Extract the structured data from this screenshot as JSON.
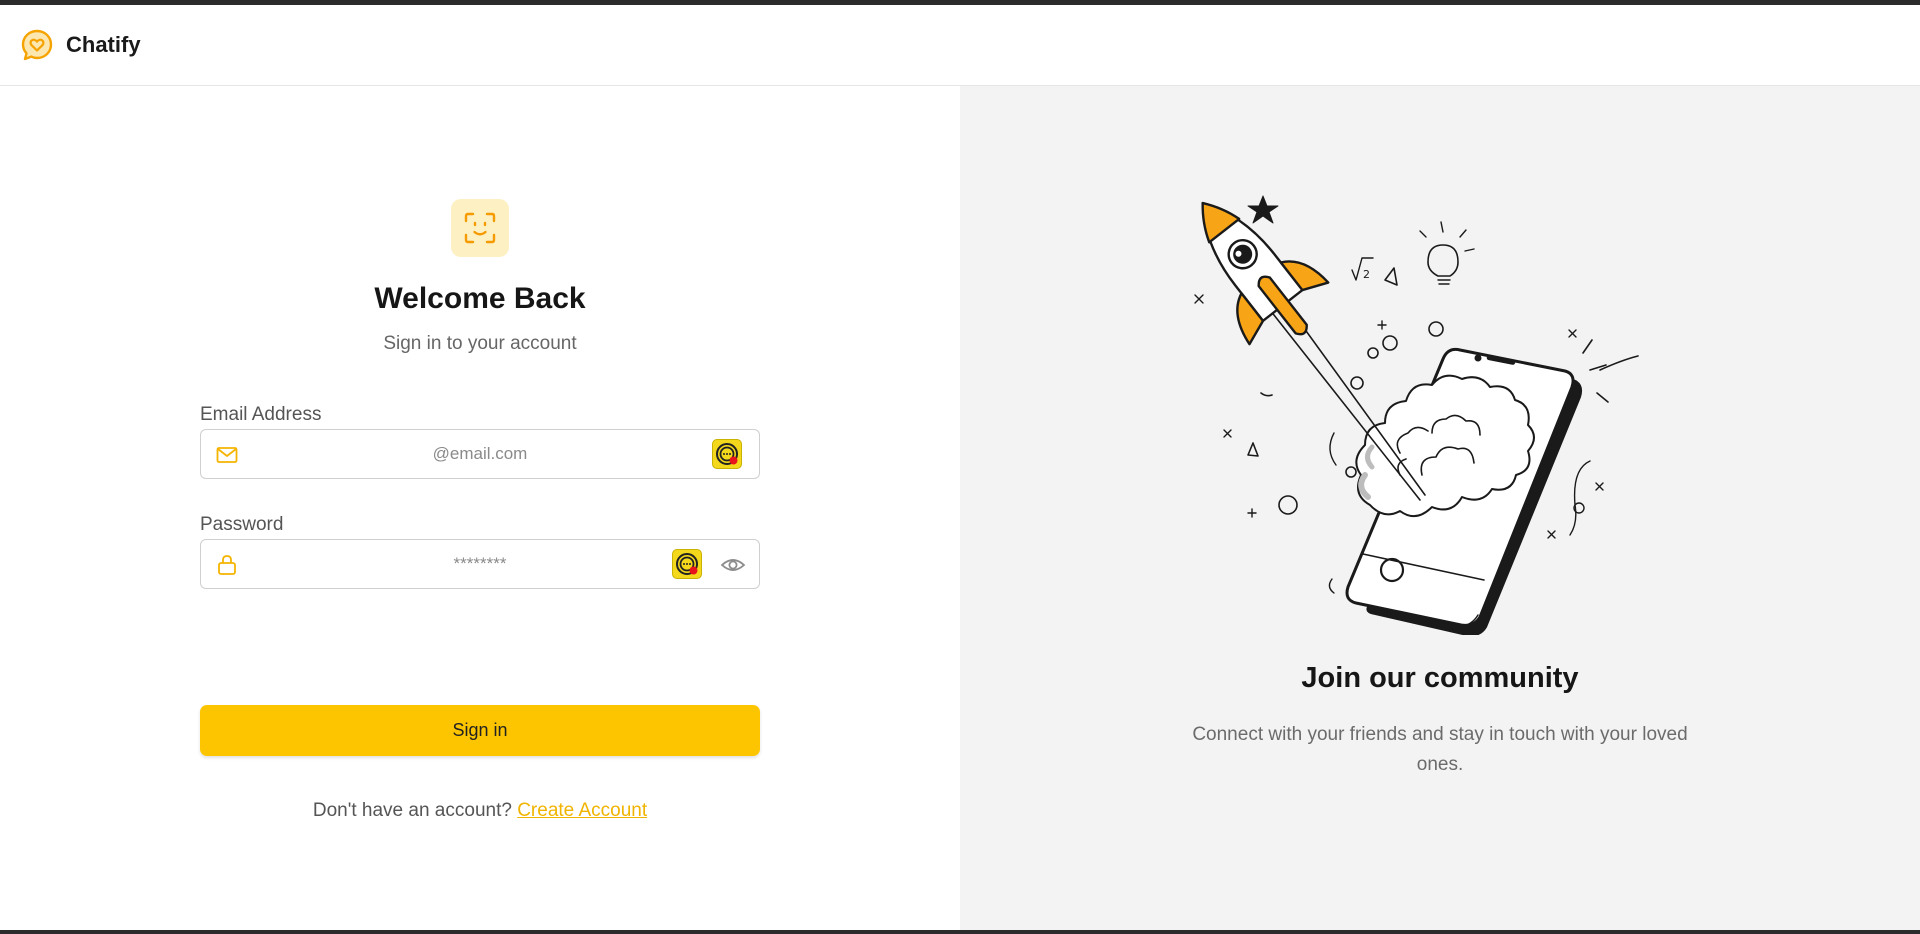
{
  "app": {
    "name": "Chatify",
    "logo_icon": "chat-heart-icon",
    "accent_color": "#fdc500"
  },
  "login": {
    "face_icon": "face-scan-icon",
    "title": "Welcome Back",
    "subtitle": "Sign in to your account",
    "email": {
      "label": "Email Address",
      "placeholder": "@email.com",
      "value": "",
      "icon": "mail-icon"
    },
    "password": {
      "label": "Password",
      "placeholder": "********",
      "value": "",
      "icon": "lock-icon",
      "toggle_icon": "eye-icon"
    },
    "extension_icon": "password-manager-extension-icon",
    "submit_label": "Sign in",
    "signup_prompt": "Don't have an account?",
    "signup_link": "Create Account"
  },
  "promo": {
    "illustration": "rocket-launching-from-phone-illustration",
    "title": "Join our community",
    "text": "Connect with your friends and stay in touch with your loved ones."
  }
}
